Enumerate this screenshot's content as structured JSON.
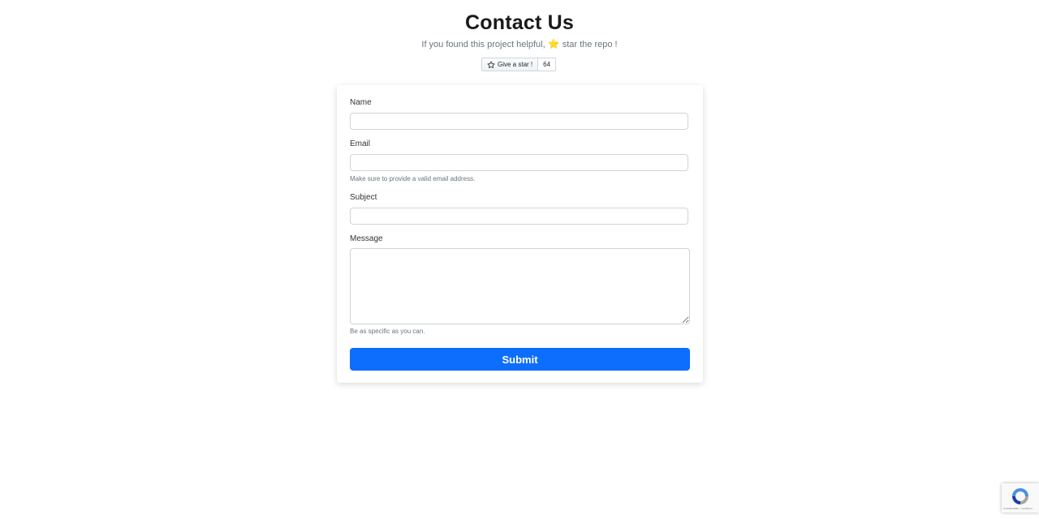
{
  "header": {
    "title": "Contact Us",
    "subtitle_before": "If you found this project helpful,",
    "subtitle_emoji": "⭐",
    "subtitle_after": "star the repo !"
  },
  "github_star": {
    "label": "Give a star !",
    "count": "64"
  },
  "form": {
    "name_label": "Name",
    "name_value": "",
    "email_label": "Email",
    "email_value": "",
    "email_help": "Make sure to provide a valid email address.",
    "subject_label": "Subject",
    "subject_value": "",
    "message_label": "Message",
    "message_value": "",
    "message_help": "Be as specific as you can.",
    "submit_label": "Submit"
  },
  "recaptcha": {
    "footer": "Confidentialité - Conditions"
  },
  "colors": {
    "primary": "#0d6efd",
    "star": "#f4b400"
  }
}
